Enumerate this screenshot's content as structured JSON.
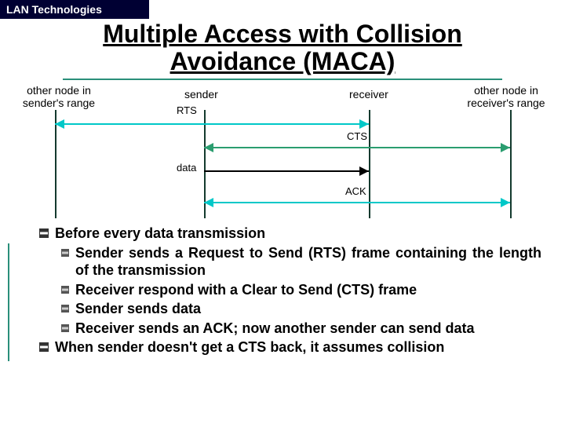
{
  "header": {
    "section": "LAN Technologies"
  },
  "title": "Multiple Access with Collision Avoidance (MACA)",
  "diagram": {
    "labels": {
      "other_sender": "other node in sender's range",
      "sender": "sender",
      "receiver": "receiver",
      "other_receiver": "other node in receiver's range"
    },
    "messages": {
      "rts": "RTS",
      "cts": "CTS",
      "data": "data",
      "ack": "ACK"
    },
    "colors": {
      "rts_arrow": "#00c8c8",
      "cts_arrow": "#2a9d6f",
      "data_arrow": "#000000",
      "ack_arrow": "#00c8c8",
      "timeline": "#143a2e"
    }
  },
  "bullets": {
    "b1": "Before every data transmission",
    "b1_items": [
      "Sender sends a Request to Send (RTS) frame containing the length of the transmission",
      "Receiver respond with a Clear to Send (CTS) frame",
      "Sender sends data",
      "Receiver sends an ACK; now another sender can send data"
    ],
    "b2": "When sender doesn't get a CTS back, it assumes collision"
  }
}
